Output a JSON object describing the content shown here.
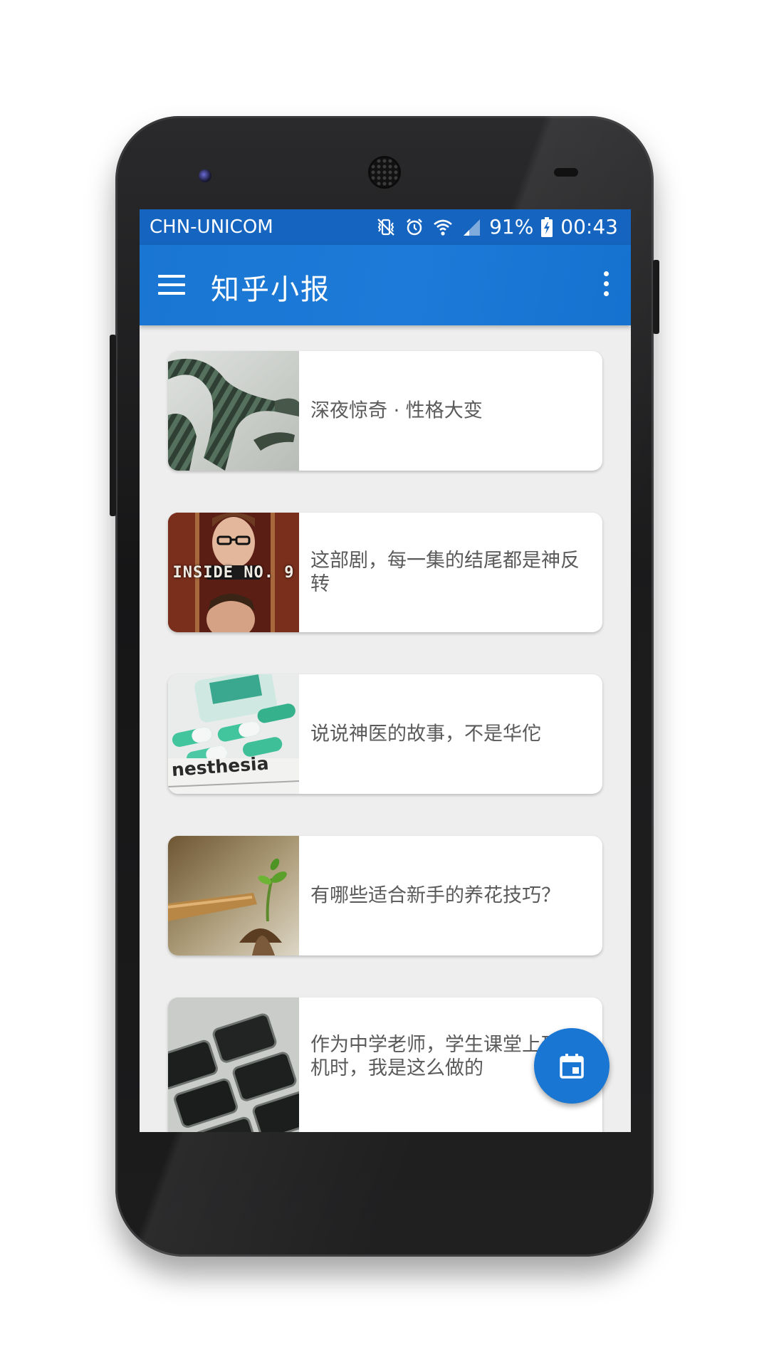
{
  "status_bar": {
    "carrier": "CHN-UNICOM",
    "battery": "91%",
    "time": "00:43",
    "icons": [
      "vibrate-icon",
      "alarm-icon",
      "wifi-icon",
      "signal-icon",
      "battery-charging-icon"
    ]
  },
  "app_bar": {
    "title": "知乎小报",
    "nav_icon": "menu-icon",
    "overflow_icon": "more-vert-icon"
  },
  "stories": [
    {
      "title": "深夜惊奇 · 性格大变",
      "thumbnail": "green-striped-arms-image"
    },
    {
      "title": "这部剧，每一集的结尾都是神反转",
      "thumbnail": "inside-no9-poster",
      "thumbnail_text": "INSIDE NO. 9"
    },
    {
      "title": "说说神医的故事，不是华佗",
      "thumbnail": "medicine-capsules-image",
      "thumbnail_text": "nesthesia"
    },
    {
      "title": "有哪些适合新手的养花技巧？",
      "thumbnail": "sprout-plant-image"
    },
    {
      "title": "作为中学老师，学生课堂上玩手机时，我是这么做的",
      "thumbnail": "phones-stack-image"
    }
  ],
  "fab": {
    "icon": "calendar-icon"
  },
  "colors": {
    "primary": "#1976d2",
    "status_bar": "#1565c0",
    "background": "#eeeeee",
    "card_text": "#5a5a5a"
  }
}
